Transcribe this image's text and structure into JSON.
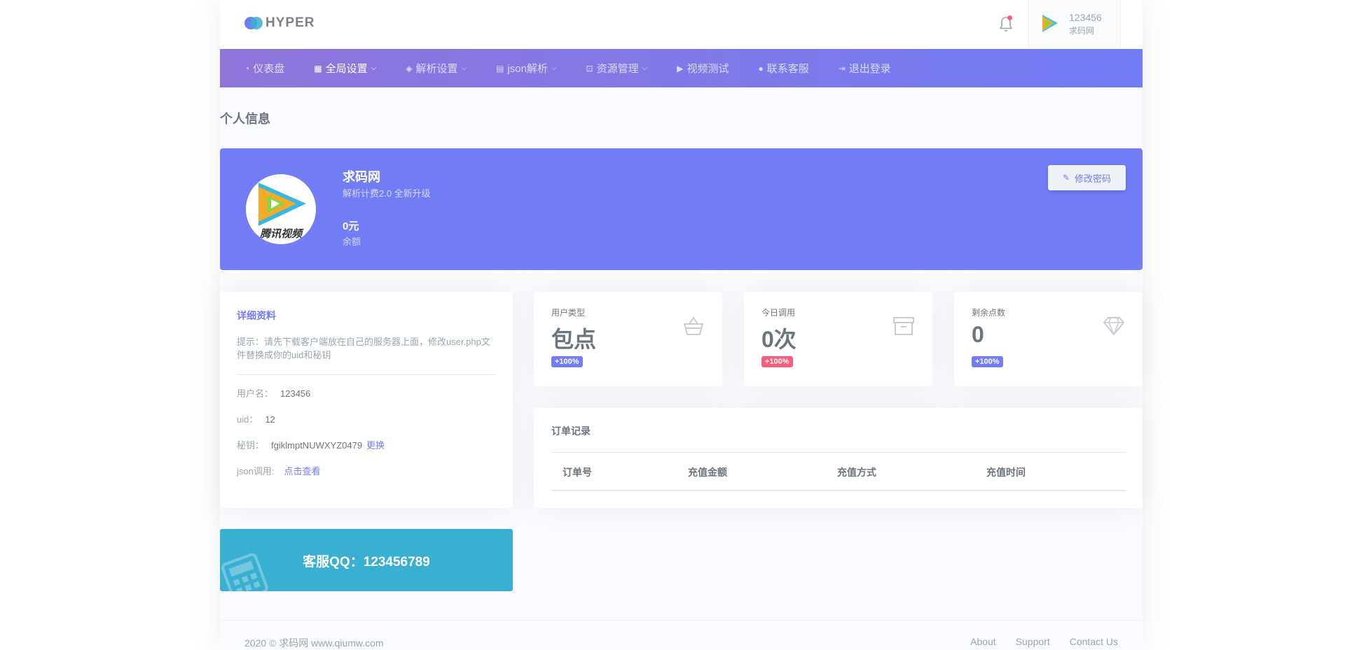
{
  "brand": {
    "logo_text": "HYPER"
  },
  "topbar": {
    "user_name": "123456",
    "user_sub": "求码网",
    "notification_dot": true
  },
  "nav": [
    {
      "icon": "dashboard-icon",
      "glyph": "◔",
      "label": "仪表盘",
      "dropdown": false,
      "active": false
    },
    {
      "icon": "grid-icon",
      "glyph": "▦",
      "label": "全局设置",
      "dropdown": true,
      "active": true
    },
    {
      "icon": "layers-icon",
      "glyph": "◈",
      "label": "解析设置",
      "dropdown": true,
      "active": false
    },
    {
      "icon": "file-icon",
      "glyph": "▤",
      "label": "json解析",
      "dropdown": true,
      "active": false
    },
    {
      "icon": "resource-icon",
      "glyph": "⊡",
      "label": "资源管理",
      "dropdown": true,
      "active": false
    },
    {
      "icon": "youtube-icon",
      "glyph": "▶",
      "label": "视频测试",
      "dropdown": false,
      "active": false
    },
    {
      "icon": "user-circle-icon",
      "glyph": "●",
      "label": "联系客服",
      "dropdown": false,
      "active": false
    },
    {
      "icon": "logout-icon",
      "glyph": "⇥",
      "label": "退出登录",
      "dropdown": false,
      "active": false
    }
  ],
  "page": {
    "title": "个人信息"
  },
  "profile": {
    "name": "求码网",
    "subtitle": "解析计费2.0 全新升级",
    "balance": "0元",
    "balance_label": "余额",
    "change_password": "修改密码",
    "avatar_text": "腾讯视频"
  },
  "detail": {
    "title": "详细资料",
    "tip": "提示：请先下载客户端放在自己的服务器上面，修改user.php文件替换成你的uid和秘钥",
    "username_label": "用户名：",
    "username": "123456",
    "uid_label": "uid：",
    "uid": "12",
    "key_label": "秘钥：",
    "key": "fgiklmptNUWXYZ0479",
    "key_action": "更换",
    "json_label": "json调用:",
    "json_action": "点击查看"
  },
  "qq": {
    "text": "客服QQ：123456789"
  },
  "stats": [
    {
      "label": "用户类型",
      "value": "包点",
      "badge": "+100%",
      "badge_color": "#727cf5",
      "icon": "basket-icon"
    },
    {
      "label": "今日调用",
      "value": "0次",
      "badge": "+100%",
      "badge_color": "#fa5c7c",
      "icon": "archive-icon"
    },
    {
      "label": "剩余点数",
      "value": "0",
      "badge": "+100%",
      "badge_color": "#727cf5",
      "icon": "diamond-icon"
    }
  ],
  "orders": {
    "title": "订单记录",
    "columns": [
      "订单号",
      "充值金额",
      "充值方式",
      "充值时间"
    ]
  },
  "footer": {
    "copyright": "2020 © 求码网 www.qiumw.com",
    "links": [
      "About",
      "Support",
      "Contact Us"
    ]
  },
  "colors": {
    "primary": "#727cf5",
    "danger": "#fa5c7c",
    "info": "#39afd1",
    "nav_start": "#8f75da"
  }
}
